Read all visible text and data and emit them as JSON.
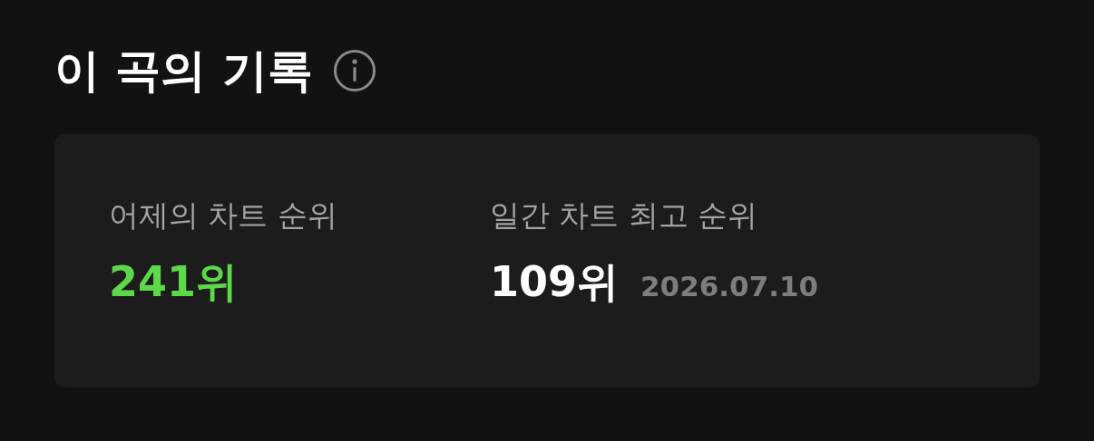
{
  "title": "이 곡의 기록",
  "stats": [
    {
      "label": "어제의 차트 순위",
      "value": "241위",
      "color": "#5cd84a"
    },
    {
      "label": "일간 차트 최고 순위",
      "value": "109위",
      "color": "#ffffff",
      "date": "2026.07.10"
    }
  ]
}
